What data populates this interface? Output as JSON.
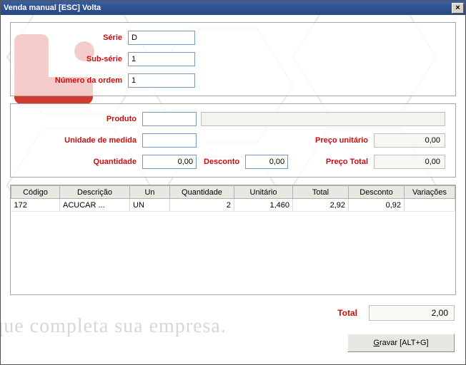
{
  "window": {
    "title": "Venda manual [ESC] Volta"
  },
  "header": {
    "serie_label": "Série",
    "serie_value": "D",
    "subserie_label": "Sub-série",
    "subserie_value": "1",
    "numero_label": "Número da ordem",
    "numero_value": "1"
  },
  "produto": {
    "produto_label": "Produto",
    "produto_code": "",
    "produto_desc": "",
    "unidade_label": "Unidade de medida",
    "unidade_value": "",
    "preco_unit_label": "Preço unitário",
    "preco_unit_value": "0,00",
    "quantidade_label": "Quantidade",
    "quantidade_value": "0,00",
    "desconto_label": "Desconto",
    "desconto_value": "0,00",
    "preco_total_label": "Preço Total",
    "preco_total_value": "0,00"
  },
  "table": {
    "headers": {
      "codigo": "Código",
      "descricao": "Descrição",
      "un": "Un",
      "quantidade": "Quantidade",
      "unitario": "Unitário",
      "total": "Total",
      "desconto": "Desconto",
      "variacoes": "Variações"
    },
    "rows": [
      {
        "codigo": "172",
        "descricao": "ACUCAR ...",
        "un": "UN",
        "quantidade": "2",
        "unitario": "1,460",
        "total": "2,92",
        "desconto": "0,92",
        "variacoes": ""
      }
    ]
  },
  "summary": {
    "total_label": "Total",
    "total_value": "2,00"
  },
  "actions": {
    "gravar": "Gravar [ALT+G]"
  },
  "background_text": "ia que completa sua empresa."
}
